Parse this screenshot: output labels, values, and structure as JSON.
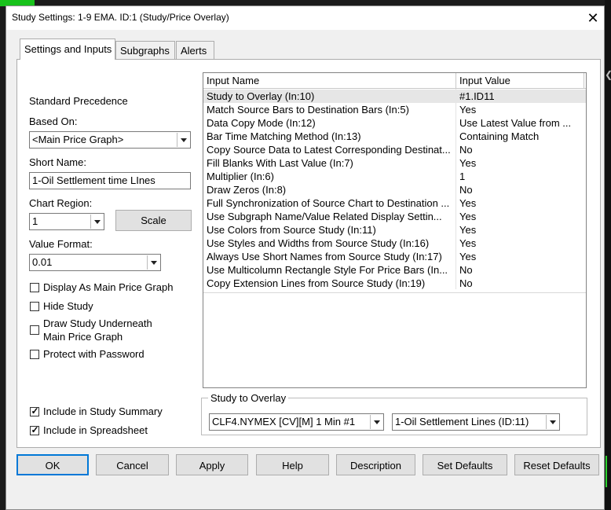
{
  "window": {
    "title": "Study Settings: 1-9 EMA. ID:1 (Study/Price Overlay)",
    "close_icon": "close-icon"
  },
  "tabs": [
    {
      "label": "Settings and Inputs",
      "active": true
    },
    {
      "label": "Subgraphs",
      "active": false
    },
    {
      "label": "Alerts",
      "active": false
    }
  ],
  "left": {
    "standard_precedence": "Standard Precedence",
    "based_on_label": "Based On:",
    "based_on_value": "<Main Price Graph>",
    "short_name_label": "Short Name:",
    "short_name_value": "1-Oil Settlement time LInes",
    "chart_region_label": "Chart Region:",
    "chart_region_value": "1",
    "scale_button": "Scale",
    "value_format_label": "Value Format:",
    "value_format_value": "0.01",
    "checkboxes": [
      {
        "label": "Display As Main Price Graph",
        "checked": false
      },
      {
        "label": "Hide Study",
        "checked": false
      },
      {
        "label": "Draw Study Underneath",
        "label2": "Main Price Graph",
        "checked": false
      },
      {
        "label": "Protect with Password",
        "checked": false
      }
    ],
    "bottom_checkboxes": [
      {
        "label": "Include in Study Summary",
        "checked": true
      },
      {
        "label": "Include in Spreadsheet",
        "checked": true
      }
    ]
  },
  "inputs_table": {
    "columns": [
      "Input Name",
      "Input Value"
    ],
    "rows": [
      {
        "name": "Study to Overlay   (In:10)",
        "value": "#1.ID11",
        "selected": true
      },
      {
        "name": "Match Source Bars to Destination Bars   (In:5)",
        "value": "Yes"
      },
      {
        "name": "Data Copy Mode   (In:12)",
        "value": "Use Latest Value from ..."
      },
      {
        "name": "Bar Time Matching Method   (In:13)",
        "value": "Containing Match"
      },
      {
        "name": "Copy Source Data to Latest Corresponding Destinat...",
        "value": "No"
      },
      {
        "name": "Fill Blanks With Last Value   (In:7)",
        "value": "Yes"
      },
      {
        "name": "Multiplier   (In:6)",
        "value": "1"
      },
      {
        "name": "Draw Zeros   (In:8)",
        "value": "No"
      },
      {
        "name": "Full Synchronization of Source Chart to Destination   ...",
        "value": "Yes"
      },
      {
        "name": "Use Subgraph Name/Value Related Display Settin...",
        "value": "Yes"
      },
      {
        "name": "Use Colors from Source Study   (In:11)",
        "value": "Yes"
      },
      {
        "name": "Use Styles and Widths from Source Study   (In:16)",
        "value": "Yes"
      },
      {
        "name": "Always Use Short Names from Source Study   (In:17)",
        "value": "Yes"
      },
      {
        "name": "Use Multicolumn Rectangle Style For Price Bars   (In...",
        "value": "No"
      },
      {
        "name": "Copy Extension Lines from Source Study   (In:19)",
        "value": "No"
      }
    ]
  },
  "overlay": {
    "group_label": "Study to Overlay",
    "chart_value": "CLF4.NYMEX [CV][M]  1 Min  #1",
    "study_value": "1-Oil Settlement Lines (ID:11)"
  },
  "buttons": {
    "ok": "OK",
    "cancel": "Cancel",
    "apply": "Apply",
    "help": "Help",
    "description": "Description",
    "set_defaults": "Set Defaults",
    "reset_defaults": "Reset Defaults"
  }
}
